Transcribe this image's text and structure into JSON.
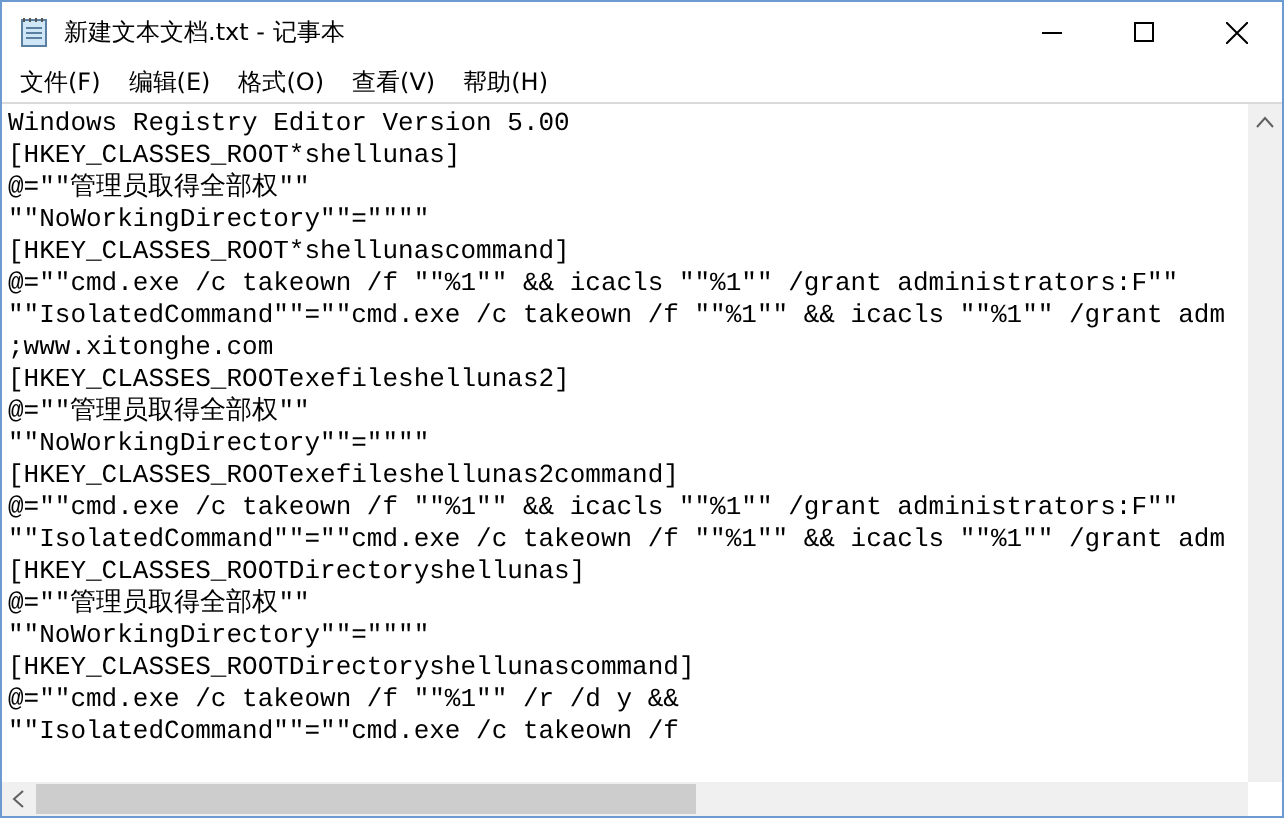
{
  "window": {
    "title": "新建文本文档.txt - 记事本"
  },
  "menu": [
    {
      "label": "文件(F)"
    },
    {
      "label": "编辑(E)"
    },
    {
      "label": "格式(O)"
    },
    {
      "label": "查看(V)"
    },
    {
      "label": "帮助(H)"
    }
  ],
  "editor": {
    "lines": [
      "Windows Registry Editor Version 5.00",
      "[HKEY_CLASSES_ROOT*shellunas]",
      "@=\"\"管理员取得全部权\"\"",
      "\"\"NoWorkingDirectory\"\"=\"\"\"\"",
      "[HKEY_CLASSES_ROOT*shellunascommand]",
      "@=\"\"cmd.exe /c takeown /f \"\"%1\"\" && icacls \"\"%1\"\" /grant administrators:F\"\"",
      "\"\"IsolatedCommand\"\"=\"\"cmd.exe /c takeown /f \"\"%1\"\" && icacls \"\"%1\"\" /grant adm",
      ";www.xitonghe.com",
      "[HKEY_CLASSES_ROOTexefileshellunas2]",
      "@=\"\"管理员取得全部权\"\"",
      "\"\"NoWorkingDirectory\"\"=\"\"\"\"",
      "[HKEY_CLASSES_ROOTexefileshellunas2command]",
      "@=\"\"cmd.exe /c takeown /f \"\"%1\"\" && icacls \"\"%1\"\" /grant administrators:F\"\"",
      "\"\"IsolatedCommand\"\"=\"\"cmd.exe /c takeown /f \"\"%1\"\" && icacls \"\"%1\"\" /grant adm",
      "[HKEY_CLASSES_ROOTDirectoryshellunas]",
      "@=\"\"管理员取得全部权\"\"",
      "\"\"NoWorkingDirectory\"\"=\"\"\"\"",
      "[HKEY_CLASSES_ROOTDirectoryshellunascommand]",
      "@=\"\"cmd.exe /c takeown /f \"\"%1\"\" /r /d y &&",
      "\"\"IsolatedCommand\"\"=\"\"cmd.exe /c takeown /f"
    ]
  }
}
